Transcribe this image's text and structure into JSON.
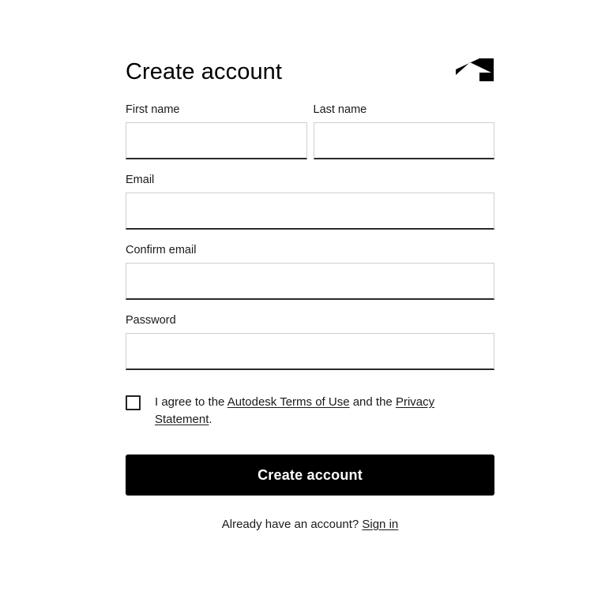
{
  "page": {
    "background_color": "#ffffff",
    "title": "Create account"
  },
  "brand": {
    "logo_name": "autodesk-logo",
    "logo_color": "#000000"
  },
  "form": {
    "first_name": {
      "label": "First name",
      "value": "",
      "placeholder": ""
    },
    "last_name": {
      "label": "Last name",
      "value": "",
      "placeholder": ""
    },
    "email": {
      "label": "Email",
      "value": "",
      "placeholder": ""
    },
    "confirm_email": {
      "label": "Confirm email",
      "value": "",
      "placeholder": ""
    },
    "password": {
      "label": "Password",
      "value": "",
      "placeholder": ""
    }
  },
  "terms": {
    "checked": false,
    "text_before": "I agree to the ",
    "link_terms": "Autodesk Terms of Use",
    "text_between": " and the ",
    "link_privacy": "Privacy Statement",
    "text_after": "."
  },
  "actions": {
    "submit_label": "Create account",
    "submit_bg": "#000000",
    "submit_fg": "#ffffff"
  },
  "footer": {
    "prompt": "Already have an account?",
    "signin_label": "Sign in"
  }
}
